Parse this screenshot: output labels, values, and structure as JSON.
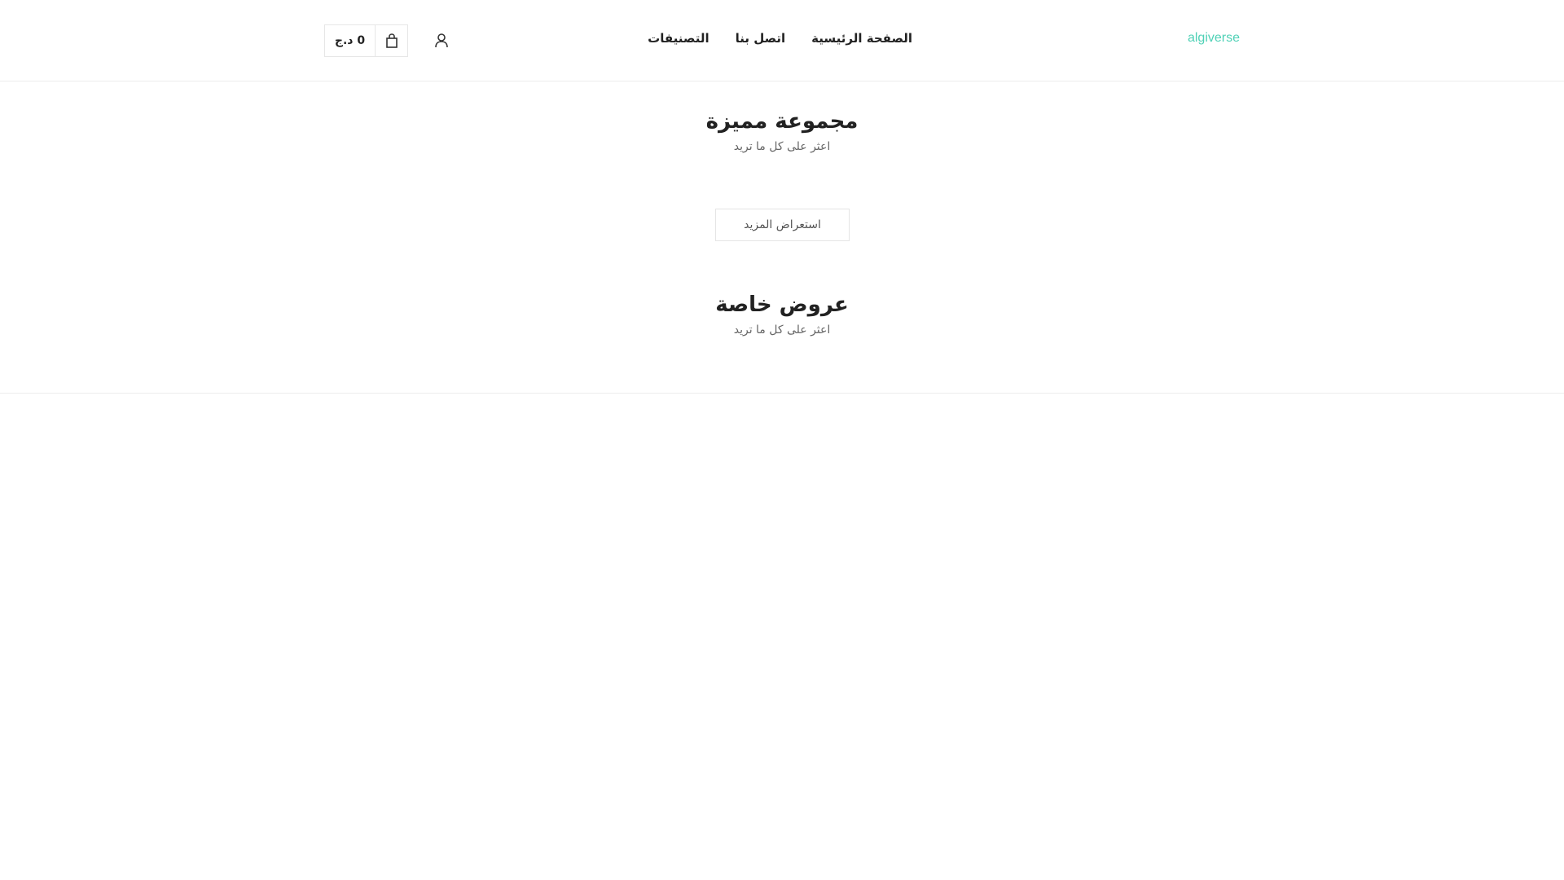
{
  "header": {
    "logo": "algiverse",
    "nav": [
      {
        "label": "الصفحة الرئيسية"
      },
      {
        "label": "اتصل بنا"
      },
      {
        "label": "التصنيفات"
      }
    ],
    "cart_total": "0 د.ج",
    "icons": {
      "user": "user-icon",
      "cart": "cart-icon"
    }
  },
  "featured": {
    "title": "مجموعة مميزة",
    "subtitle": "اعثر على كل ما تريد",
    "more_label": "استعراض المزيد"
  },
  "offers": {
    "title": "عروض خاصة",
    "subtitle": "اعثر على كل ما تريد"
  },
  "colors": {
    "accent": "#4fd1b6",
    "text": "#222222",
    "muted": "#666666",
    "border": "#ececec"
  }
}
